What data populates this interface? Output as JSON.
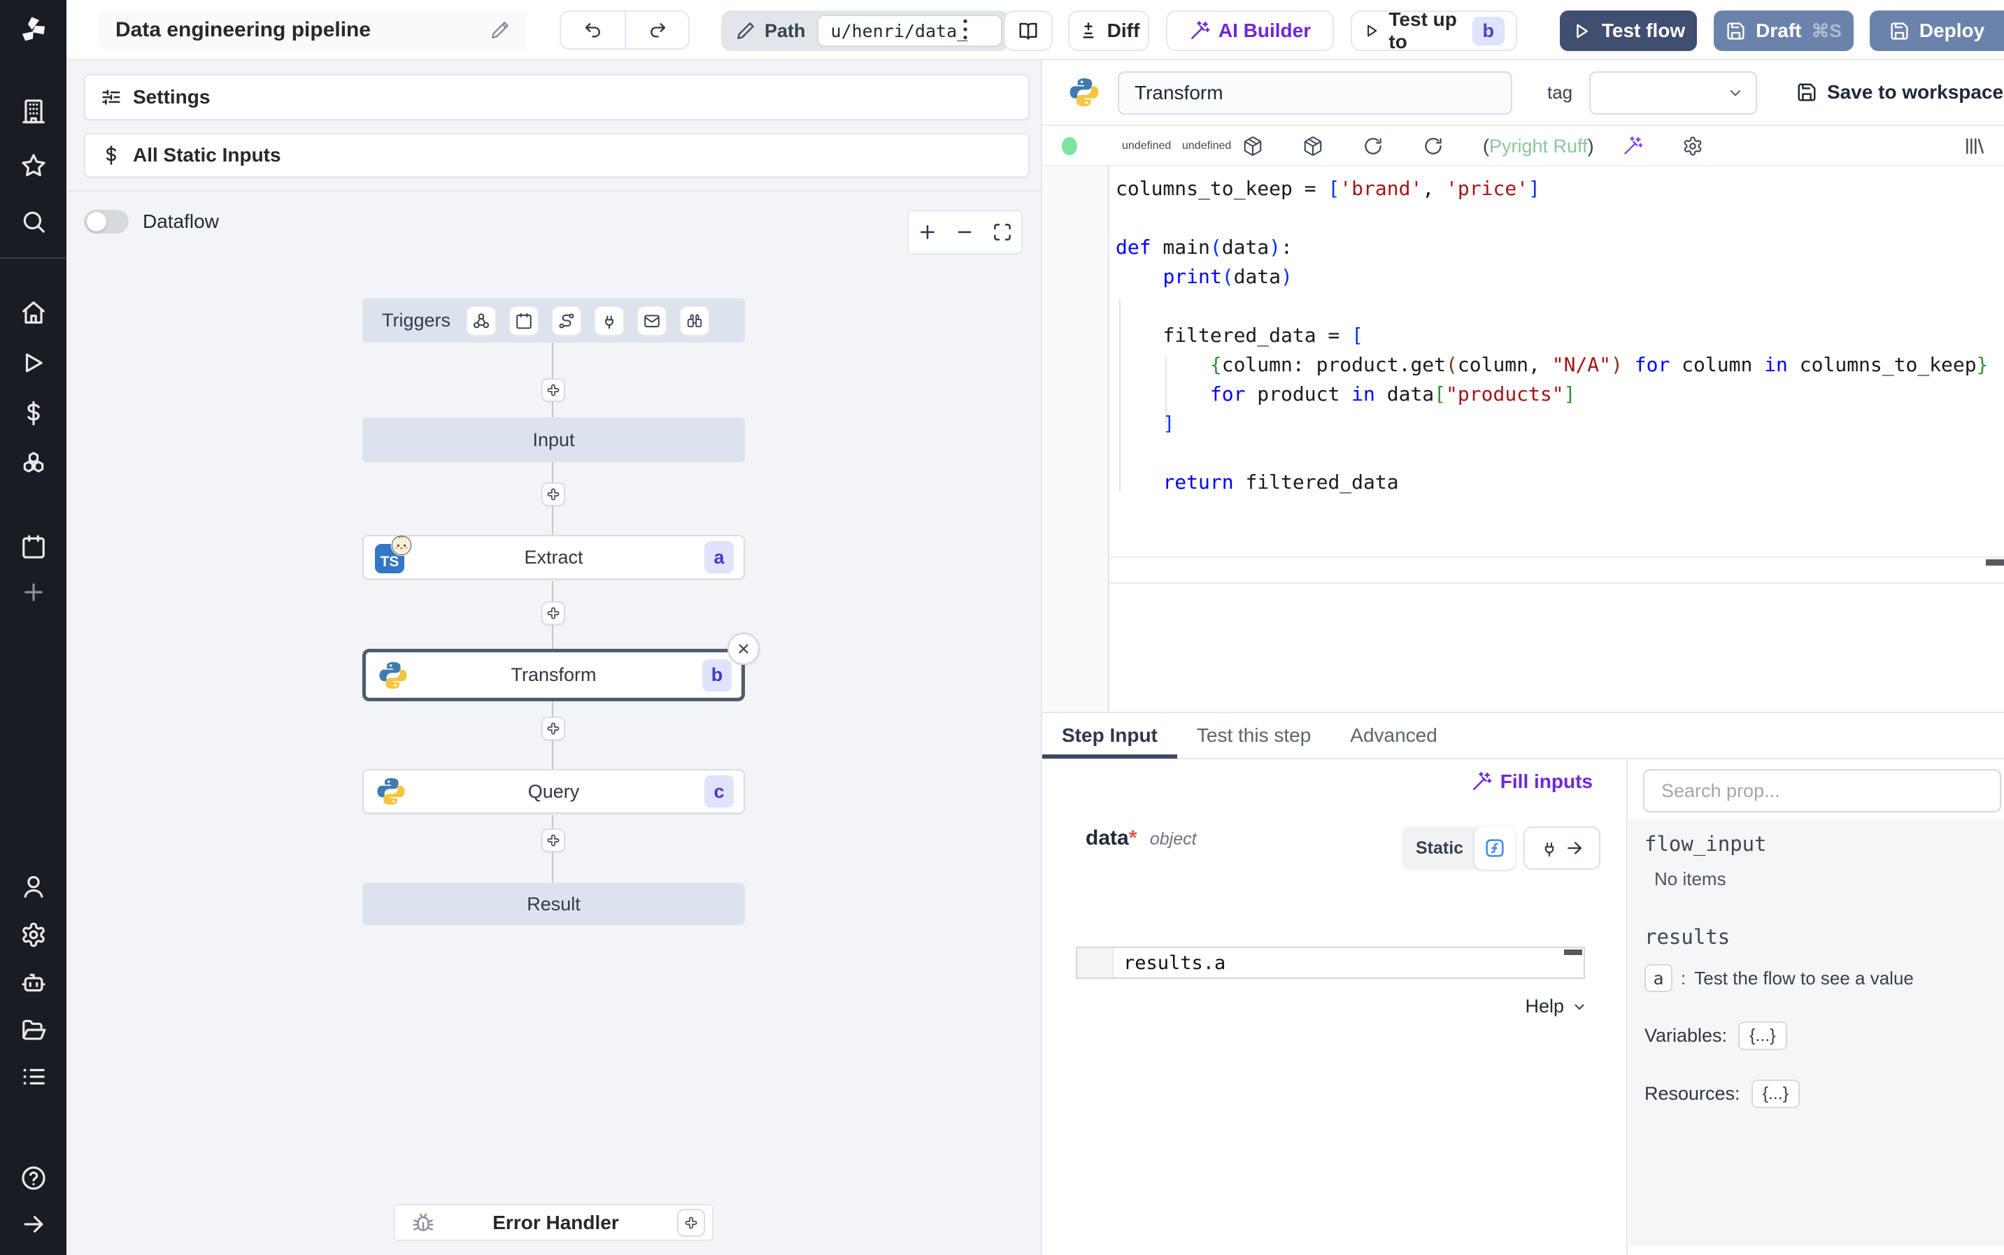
{
  "topbar": {
    "title": "Data engineering pipeline",
    "path_label": "Path",
    "path_value": "u/henri/data_",
    "diff_label": "Diff",
    "ai_builder_label": "AI Builder",
    "test_up_to_label": "Test up to",
    "test_up_to_badge": "b",
    "test_flow_label": "Test flow",
    "draft_label": "Draft",
    "draft_shortcut": "⌘S",
    "deploy_label": "Deploy"
  },
  "sidebar": {
    "top_icons": [
      "building-icon",
      "star-icon",
      "search-icon"
    ],
    "main_icons": [
      "home-icon",
      "runs-icon",
      "variables-icon",
      "resources-icon",
      "schedules-icon",
      "add-icon"
    ],
    "lower_icons": [
      "user-icon",
      "settings-icon",
      "workers-icon",
      "folders-icon",
      "audit-logs-icon"
    ],
    "footer_icons": [
      "help-icon",
      "expand-sidebar-icon"
    ]
  },
  "canvas": {
    "settings_label": "Settings",
    "all_static_inputs_label": "All Static Inputs",
    "dataflow_label": "Dataflow",
    "triggers_label": "Triggers",
    "trigger_icons": [
      "webhook-icon",
      "schedule-icon",
      "route-icon",
      "websocket-icon",
      "email-icon",
      "poll-icon"
    ],
    "nodes": [
      {
        "label": "Input"
      },
      {
        "label": "Extract",
        "badge": "a",
        "lang": "bun"
      },
      {
        "label": "Transform",
        "badge": "b",
        "lang": "python",
        "selected": true
      },
      {
        "label": "Query",
        "badge": "c",
        "lang": "python"
      },
      {
        "label": "Result"
      }
    ],
    "error_handler_label": "Error Handler"
  },
  "editor": {
    "step_name": "Transform",
    "tag_label": "tag",
    "save_label": "Save to workspace",
    "lint_open": "(",
    "lint_label": "Pyright Ruff",
    "lint_close": ")",
    "toolbar_icons": [
      "status-dot",
      "variable-icon",
      "variable-icon",
      "package-icon",
      "package-icon",
      "reload-icon",
      "reload-icon",
      "lint-text",
      "ai-wand-icon",
      "gear-icon"
    ],
    "code_lines": [
      [
        {
          "t": "columns_to_keep = ",
          "s": "d"
        },
        {
          "t": "[",
          "s": "b1"
        },
        {
          "t": "'brand'",
          "s": "str"
        },
        {
          "t": ", ",
          "s": "d"
        },
        {
          "t": "'price'",
          "s": "str"
        },
        {
          "t": "]",
          "s": "b1"
        }
      ],
      [],
      [
        {
          "t": "def",
          "s": "kw"
        },
        {
          "t": " main",
          "s": "d"
        },
        {
          "t": "(",
          "s": "b1"
        },
        {
          "t": "data",
          "s": "d"
        },
        {
          "t": ")",
          "s": "b1"
        },
        {
          "t": ":",
          "s": "d"
        }
      ],
      [
        {
          "t": "    ",
          "s": "d"
        },
        {
          "t": "print",
          "s": "kw"
        },
        {
          "t": "(",
          "s": "b1"
        },
        {
          "t": "data",
          "s": "d"
        },
        {
          "t": ")",
          "s": "b1"
        }
      ],
      [],
      [
        {
          "t": "    filtered_data = ",
          "s": "d"
        },
        {
          "t": "[",
          "s": "b1"
        }
      ],
      [
        {
          "t": "        ",
          "s": "d"
        },
        {
          "t": "{",
          "s": "b2"
        },
        {
          "t": "column: product.get",
          "s": "d"
        },
        {
          "t": "(",
          "s": "b3"
        },
        {
          "t": "column, ",
          "s": "d"
        },
        {
          "t": "\"N/A\"",
          "s": "str"
        },
        {
          "t": ")",
          "s": "b3"
        },
        {
          "t": " ",
          "s": "d"
        },
        {
          "t": "for",
          "s": "kw"
        },
        {
          "t": " column ",
          "s": "d"
        },
        {
          "t": "in",
          "s": "kw"
        },
        {
          "t": " columns_to_keep",
          "s": "d"
        },
        {
          "t": "}",
          "s": "b2"
        }
      ],
      [
        {
          "t": "        ",
          "s": "d"
        },
        {
          "t": "for",
          "s": "kw"
        },
        {
          "t": " product ",
          "s": "d"
        },
        {
          "t": "in",
          "s": "kw"
        },
        {
          "t": " data",
          "s": "d"
        },
        {
          "t": "[",
          "s": "b2"
        },
        {
          "t": "\"products\"",
          "s": "str"
        },
        {
          "t": "]",
          "s": "b2"
        }
      ],
      [
        {
          "t": "    ",
          "s": "d"
        },
        {
          "t": "]",
          "s": "b1"
        }
      ],
      [],
      [
        {
          "t": "    ",
          "s": "d"
        },
        {
          "t": "return",
          "s": "kw"
        },
        {
          "t": " filtered_data",
          "s": "d"
        }
      ]
    ]
  },
  "tabs": [
    {
      "label": "Step Input",
      "active": true
    },
    {
      "label": "Test this step",
      "active": false
    },
    {
      "label": "Advanced",
      "active": false
    }
  ],
  "step_input": {
    "fill_inputs_label": "Fill inputs",
    "field_name": "data",
    "field_required": "*",
    "field_type": "object",
    "static_label": "Static",
    "expression": "results.a",
    "help_label": "Help"
  },
  "props": {
    "search_placeholder": "Search prop...",
    "flow_input_label": "flow_input",
    "flow_input_empty": "No items",
    "results_label": "results",
    "result_key": "a",
    "result_separator": ":",
    "result_hint": "Test the flow to see a value",
    "variables_label": "Variables:",
    "variables_value": "{...}",
    "resources_label": "Resources:",
    "resources_value": "{...}"
  },
  "colors": {
    "accent_purple": "#6d28d9",
    "test_flow_bg": "#404e6f",
    "deploy_bg": "#6b83aa",
    "badge_bg": "#dfe3fb",
    "badge_text": "#4338ca",
    "lint_green": "#8bc79a",
    "status_green": "#7ce3a1",
    "sidebar_bg": "#191c22",
    "canvas_bg": "#f2f4f7",
    "virtual_node_bg": "#dce3ec"
  }
}
